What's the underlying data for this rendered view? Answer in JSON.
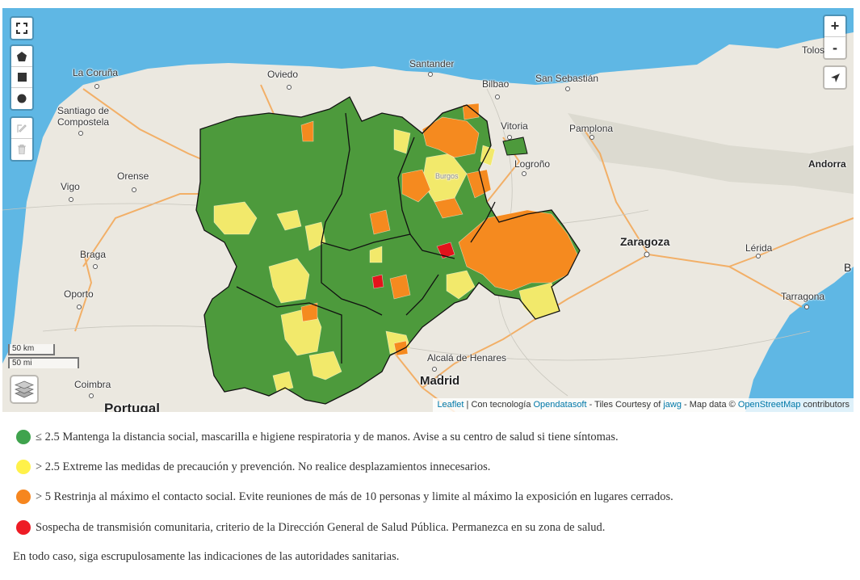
{
  "map": {
    "cities": [
      {
        "name": "La Coruña",
        "id": "la-coruna"
      },
      {
        "name": "Oviedo",
        "id": "oviedo"
      },
      {
        "name": "Santander",
        "id": "santander"
      },
      {
        "name": "Bilbao",
        "id": "bilbao"
      },
      {
        "name": "San Sebastián",
        "id": "san-sebastian"
      },
      {
        "name": "Tolosa",
        "id": "tolosa"
      },
      {
        "name": "Santiago de",
        "id": "santiago-1"
      },
      {
        "name": "Compostela",
        "id": "santiago-2"
      },
      {
        "name": "Vitoria",
        "id": "vitoria"
      },
      {
        "name": "Pamplona",
        "id": "pamplona"
      },
      {
        "name": "Orense",
        "id": "orense"
      },
      {
        "name": "Logroño",
        "id": "logrono"
      },
      {
        "name": "Andorra",
        "id": "andorra"
      },
      {
        "name": "Vigo",
        "id": "vigo"
      },
      {
        "name": "Zaragoza",
        "id": "zaragoza"
      },
      {
        "name": "Braga",
        "id": "braga"
      },
      {
        "name": "Lérida",
        "id": "lerida"
      },
      {
        "name": "Oporto",
        "id": "oporto"
      },
      {
        "name": "Tarragona",
        "id": "tarragona"
      },
      {
        "name": "Alcalá de Henares",
        "id": "alcala"
      },
      {
        "name": "Madrid",
        "id": "madrid"
      },
      {
        "name": "Coimbra",
        "id": "coimbra"
      },
      {
        "name": "Portugal",
        "id": "portugal"
      },
      {
        "name": "Burgos",
        "id": "burgos"
      },
      {
        "name": "B",
        "id": "b-edge"
      }
    ],
    "zoom_in": "+",
    "zoom_out": "-",
    "scale_km": "50 km",
    "scale_mi": "50 mi",
    "attribution": {
      "leaflet": "Leaflet",
      "sep1": " | Con tecnología ",
      "opendatasoft": "Opendatasoft",
      "sep2": " - Tiles Courtesy of ",
      "jawg": "jawg",
      "sep3": " - Map data © ",
      "osm": "OpenStreetMap",
      "sep4": " contributors"
    },
    "icons": [
      "fullscreen-icon",
      "polygon-icon",
      "square-icon",
      "circle-icon",
      "edit-icon",
      "trash-icon",
      "locate-icon",
      "layers-icon"
    ],
    "colors": {
      "green": "#4d9a3c",
      "yellow": "#f2e96b",
      "orange": "#f58a1f",
      "red": "#e3131b",
      "sea": "#5fb3e0",
      "land": "#ebe8e0"
    }
  },
  "legend": [
    {
      "color": "#3fa34d",
      "text": "≤ 2.5 Mantenga la distancia social, mascarilla e higiene respiratoria y de manos. Avise a su centro de salud si tiene síntomas."
    },
    {
      "color": "#fff14a",
      "text": "> 2.5 Extreme las medidas de precaución y prevención. No realice desplazamientos innecesarios."
    },
    {
      "color": "#f6861f",
      "text": "> 5 Restrinja al máximo el contacto social. Evite reuniones de más de 10 personas y limite al máximo la exposición en lugares cerrados."
    },
    {
      "color": "#ee1c25",
      "text": "Sospecha de transmisión comunitaria, criterio de la Dirección General de Salud Pública. Permanezca en su zona de salud."
    }
  ],
  "note": "En todo caso, siga escrupulosamente las indicaciones de las autoridades sanitarias."
}
